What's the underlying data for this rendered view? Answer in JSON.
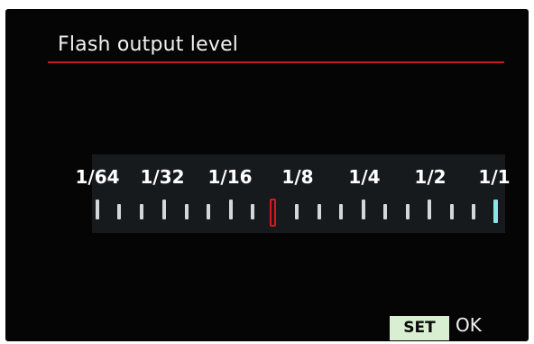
{
  "screen": {
    "title": "Flash output level",
    "accent_color": "#c8171e"
  },
  "scale": {
    "labels": [
      "1/64",
      "1/32",
      "1/16",
      "1/8",
      "1/4",
      "1/2",
      "1/1"
    ],
    "selected_value": "1/8",
    "selected_marker_color": "#d61921",
    "end_marker_color": "#8ee3e6"
  },
  "footer": {
    "set_button": "SET",
    "ok_label": "OK"
  }
}
